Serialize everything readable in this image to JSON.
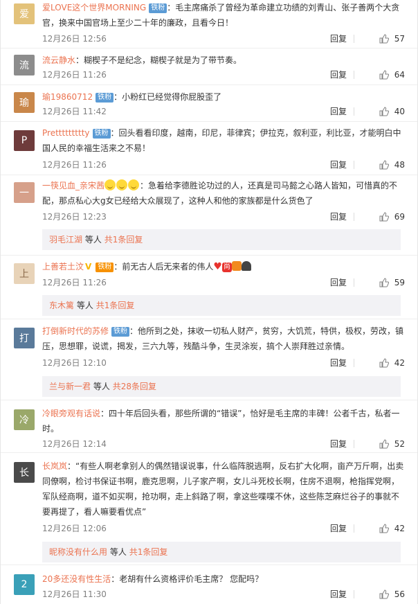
{
  "labels": {
    "reply": "回复",
    "same_person": "等人",
    "total_prefix": "共",
    "total_suffix": "条回复"
  },
  "comments": [
    {
      "user": "爱LOVE这个世界MORNING",
      "badge": "铁粉",
      "text": "：毛主席痛杀了曾经为革命建立功绩的刘青山、张子善两个大贪官，换来中国官场上至少二十年的廉政，且看今日！",
      "time": "12月26日 12:56",
      "likes": "57",
      "avatar_color": "#e3c27a"
    },
    {
      "user": "流云静水",
      "text": "：糊楔子不是纪念，糊楔子就是为了带节奏。",
      "time": "12月26日 11:26",
      "likes": "64",
      "avatar_color": "#8c8c8c"
    },
    {
      "user": "瑜19860712",
      "badge": "铁粉",
      "text": "：小粉红已经觉得你屁股歪了",
      "time": "12月26日 11:42",
      "likes": "40",
      "avatar_color": "#c9874a"
    },
    {
      "user": "Prettttttttty",
      "badge": "铁粉",
      "text": "：回头看看印度，越南，印尼，菲律宾；伊拉克，叙利亚，利比亚，才能明白中国人民的幸福生活来之不易！",
      "time": "12月26日 11:26",
      "likes": "48",
      "avatar_color": "#6e3b3b"
    },
    {
      "user": "一筷见血_亲宋茜",
      "text": "：急着给李德胜论功过的人，还真是司马懿之心路人皆知，可惜真的不配，那点私心大g女已经给大众展现了，这种人和他的家族都是什么货色了",
      "time": "12月26日 12:23",
      "likes": "69",
      "avatar_color": "#d6a08a",
      "sub": {
        "user": "羽毛江湖",
        "count": "1"
      }
    },
    {
      "user": "上善若土汶",
      "badge": "铁粉",
      "text": "：前无古人后无来者的伟人",
      "time": "12月26日 11:26",
      "likes": "59",
      "avatar_color": "#e8d3b8",
      "sub": {
        "user": "东木篱",
        "count": "1"
      }
    },
    {
      "user": "打倒新时代的苏修",
      "badge": "铁粉",
      "text": "：他所到之处，抹收一切私人财产，贫穷，大饥荒，特供，极权，劳改，镇压，思想罪，说谎，揭发，三六九等，残酷斗争，生灵涂炭，搞个人崇拜胜过亲情。",
      "time": "12月26日 12:10",
      "likes": "42",
      "avatar_color": "#5a7a9a",
      "sub": {
        "user": "兰与新一君",
        "count": "28"
      }
    },
    {
      "user": "冷眼旁观有话说",
      "text": "：四十年后回头看，那些所谓的“错误”，恰好是毛主席的丰碑！公者千古，私者一时。",
      "time": "12月26日 12:14",
      "likes": "52",
      "avatar_color": "#9aa86a"
    },
    {
      "user": "长岚岚",
      "text": "：“有些人啊老拿别人的偶然错误说事，什么临阵脱逃啊，反右扩大化啊，亩产万斤啊，出卖同僚啊，检讨书保证书啊，鹿克思啊，儿子家产啊，女儿斗死校长啊，住房不退啊，枪指挥党啊，军队经商啊，道不如买啊，抢功啊，走上斜路了啊，拿这些喋喋不休，这些陈芝麻烂谷子的事就不要再提了，看人嘛要看优点”",
      "time": "12月26日 12:06",
      "likes": "42",
      "avatar_color": "#4a4a4a",
      "sub": {
        "user": "昵称没有什么用",
        "count": "1"
      }
    },
    {
      "user": "20多还没有性生活",
      "text": "：老胡有什么资格评价毛主席？ 您配吗？",
      "time": "12月26日 11:30",
      "likes": "56",
      "avatar_color": "#3aa0b8"
    }
  ]
}
